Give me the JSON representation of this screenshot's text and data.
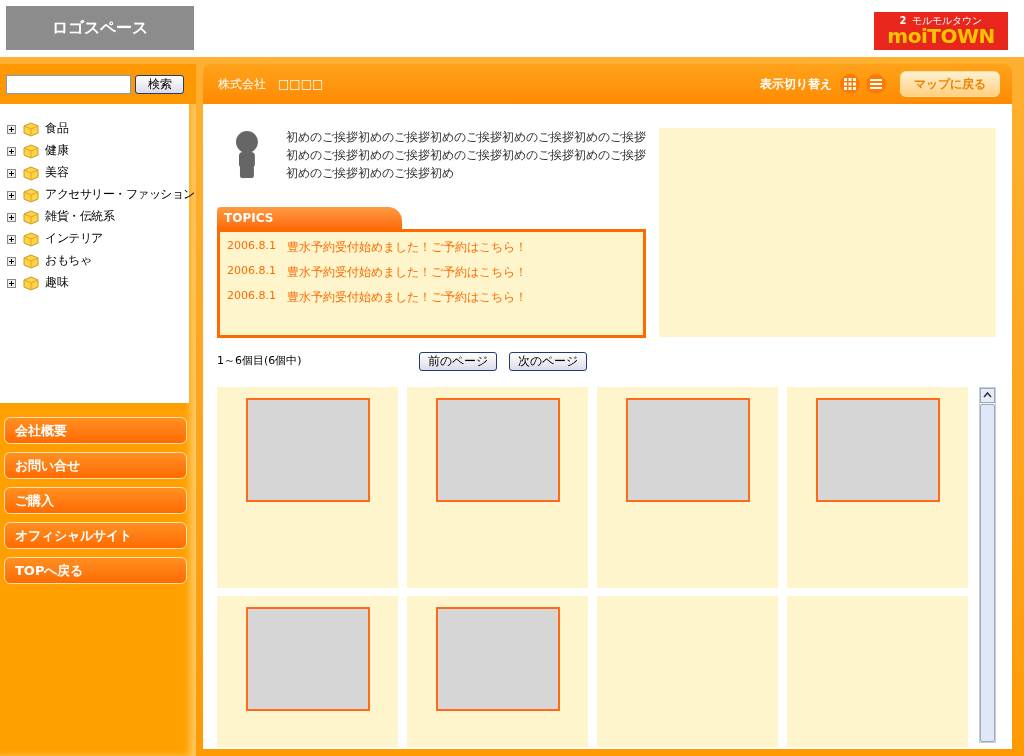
{
  "header": {
    "logo_space": "ロゴスペース",
    "brand": {
      "name": "moiTOWN",
      "mark": "2",
      "reading": "モルモルタウン"
    }
  },
  "sidebar": {
    "search": {
      "button": "検索"
    },
    "categories": [
      {
        "label": "食品",
        "expanded": false
      },
      {
        "label": "健康",
        "expanded": false
      },
      {
        "label": "美容",
        "expanded": false
      },
      {
        "label": "アクセサリー・ファッション",
        "expanded": false
      },
      {
        "label": "雑貨・伝統系",
        "expanded": false
      },
      {
        "label": "インテリア",
        "expanded": false
      },
      {
        "label": "おもちゃ",
        "expanded": false
      },
      {
        "label": "趣味",
        "expanded": false
      }
    ],
    "links": [
      "会社概要",
      "お問い合せ",
      "ご購入",
      "オフィシャルサイト",
      "TOPへ戻る"
    ]
  },
  "main": {
    "company": "株式会社　□□□□",
    "view_label": "表示切り替え",
    "back_button": "マップに戻る",
    "greeting": "初めのご挨拶初めのご挨拶初めのご挨拶初めのご挨拶初めのご挨拶初めのご挨拶初めのご挨拶初めのご挨拶初めのご挨拶初めのご挨拶初めのご挨拶初めのご挨拶初め",
    "topics": {
      "title": "TOPICS",
      "items": [
        {
          "date": "2006.8.1",
          "text": "豊水予約受付始めました！ご予約はこちら！"
        },
        {
          "date": "2006.8.1",
          "text": "豊水予約受付始めました！ご予約はこちら！"
        },
        {
          "date": "2006.8.1",
          "text": "豊水予約受付始めました！ご予約はこちら！"
        }
      ]
    },
    "count": "1～6個目(6個中)",
    "prev": "前のページ",
    "next": "次のページ",
    "products": [
      {
        "kind": "image"
      },
      {
        "kind": "image"
      },
      {
        "kind": "image"
      },
      {
        "kind": "image"
      },
      {
        "kind": "image"
      },
      {
        "kind": "image"
      },
      {
        "kind": "empty"
      },
      {
        "kind": "empty"
      }
    ]
  }
}
